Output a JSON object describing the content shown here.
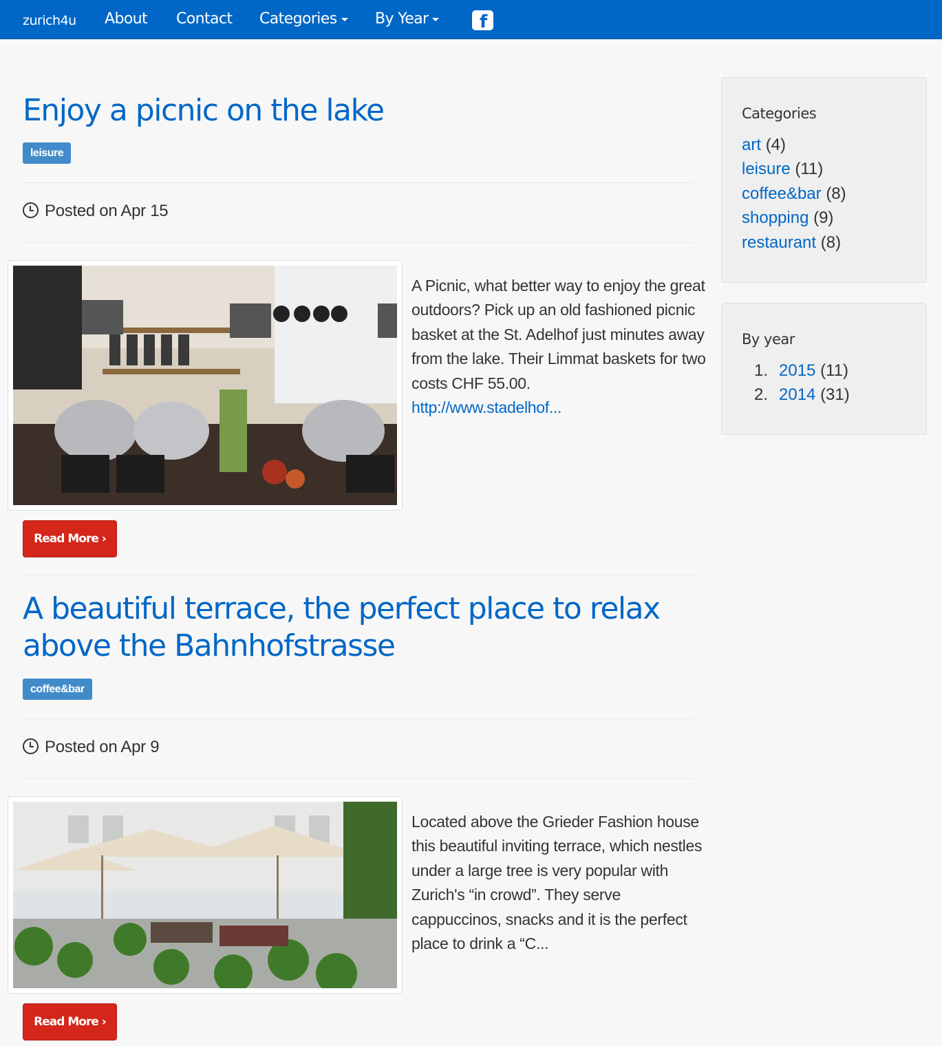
{
  "navbar": {
    "brand": "zurich4u",
    "items": [
      {
        "label": "About"
      },
      {
        "label": "Contact"
      },
      {
        "label": "Categories"
      },
      {
        "label": "By Year"
      }
    ],
    "facebook_icon": "f"
  },
  "posts": [
    {
      "title": "Enjoy a picnic on the lake",
      "category": "leisure",
      "posted": "Posted on Apr 15",
      "image_alt": "kitchen-counter-photo",
      "excerpt": "A Picnic, what better way to enjoy the great outdoors? Pick up an old fashioned picnic basket at the St. Adelhof just minutes away from the lake. Their Limmat baskets for two costs CHF 55.00.",
      "link": "http://www.stadelhof...",
      "read_more": "Read More"
    },
    {
      "title": "A beautiful terrace, the perfect place to relax above the Bahnhofstrasse",
      "category": "coffee&bar",
      "posted": "Posted on Apr 9",
      "image_alt": "terrace-photo",
      "excerpt": "Located above the Grieder Fashion house this beautiful inviting terrace, which nestles under a large tree is very popular with Zurich's  “in crowd”. They serve cappuccinos, snacks and it is the perfect place to drink a “C...",
      "read_more": "Read More"
    }
  ],
  "sidebar": {
    "categories_title": "Categories",
    "categories": [
      {
        "name": "art",
        "count": "(4)"
      },
      {
        "name": "leisure",
        "count": "(11)"
      },
      {
        "name": "coffee&bar",
        "count": "(8)"
      },
      {
        "name": "shopping",
        "count": "(9)"
      },
      {
        "name": "restaurant",
        "count": "(8)"
      }
    ],
    "years_title": "By year",
    "years": [
      {
        "num": "1.",
        "year": "2015",
        "count": "(11)"
      },
      {
        "num": "2.",
        "year": "2014",
        "count": "(31)"
      }
    ]
  },
  "colors": {
    "navbar": "#0067c7",
    "link": "#0067c7",
    "label": "#428bca",
    "button": "#d4261a"
  }
}
